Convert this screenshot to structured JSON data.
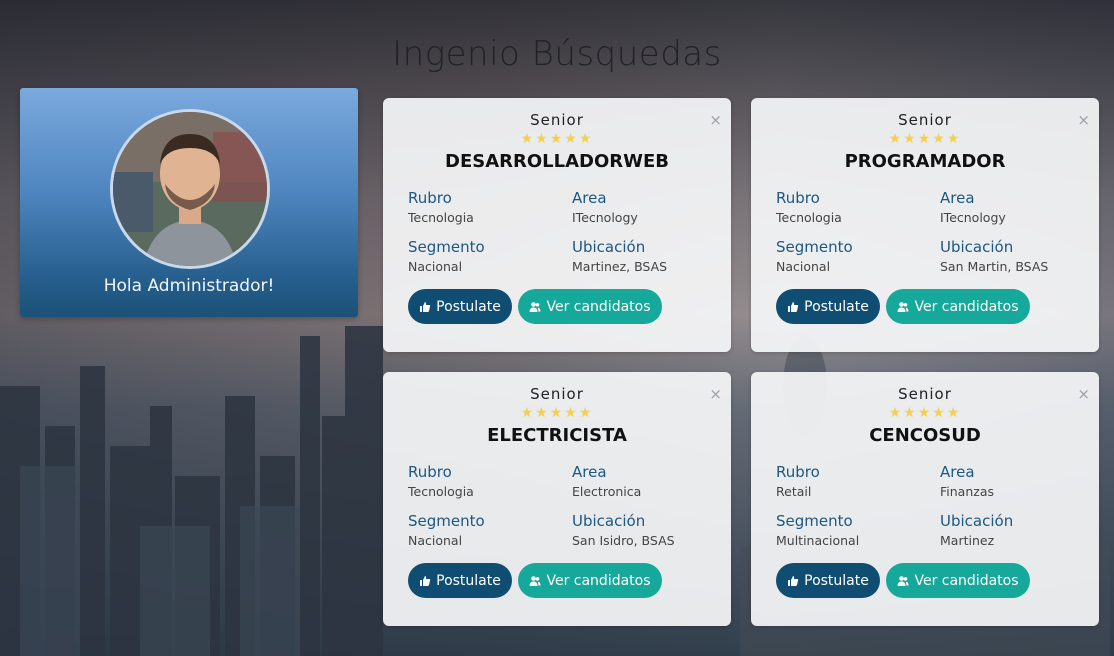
{
  "page": {
    "title": "Ingenio Búsquedas"
  },
  "profile": {
    "greeting": "Hola Administrador!"
  },
  "stars": "★★★★★",
  "close_glyph": "×",
  "jobs": [
    {
      "level": "Senior",
      "name": "DESARROLLADORWEB",
      "rubro_label": "Rubro",
      "rubro": "Tecnologia",
      "area_label": "Area",
      "area": "ITecnology",
      "segmento_label": "Segmento",
      "segmento": "Nacional",
      "ubicacion_label": "Ubicación",
      "ubicacion": "Martinez, BSAS",
      "postulate": "Postulate",
      "ver": "Ver candidatos"
    },
    {
      "level": "Senior",
      "name": "PROGRAMADOR",
      "rubro_label": "Rubro",
      "rubro": "Tecnologia",
      "area_label": "Area",
      "area": "ITecnology",
      "segmento_label": "Segmento",
      "segmento": "Nacional",
      "ubicacion_label": "Ubicación",
      "ubicacion": "San Martin, BSAS",
      "postulate": "Postulate",
      "ver": "Ver candidatos"
    },
    {
      "level": "Senior",
      "name": "ELECTRICISTA",
      "rubro_label": "Rubro",
      "rubro": "Tecnologia",
      "area_label": "Area",
      "area": "Electronica",
      "segmento_label": "Segmento",
      "segmento": "Nacional",
      "ubicacion_label": "Ubicación",
      "ubicacion": "San Isidro, BSAS",
      "postulate": "Postulate",
      "ver": "Ver candidatos"
    },
    {
      "level": "Senior",
      "name": "CENCOSUD",
      "rubro_label": "Rubro",
      "rubro": "Retail",
      "area_label": "Area",
      "area": "Finanzas",
      "segmento_label": "Segmento",
      "segmento": "Multinacional",
      "ubicacion_label": "Ubicación",
      "ubicacion": "Martinez",
      "postulate": "Postulate",
      "ver": "Ver candidatos"
    }
  ],
  "colors": {
    "accent_dark": "#0f4d73",
    "accent_teal": "#16a89a",
    "label_blue": "#1d5782",
    "star": "#f4cf52"
  }
}
